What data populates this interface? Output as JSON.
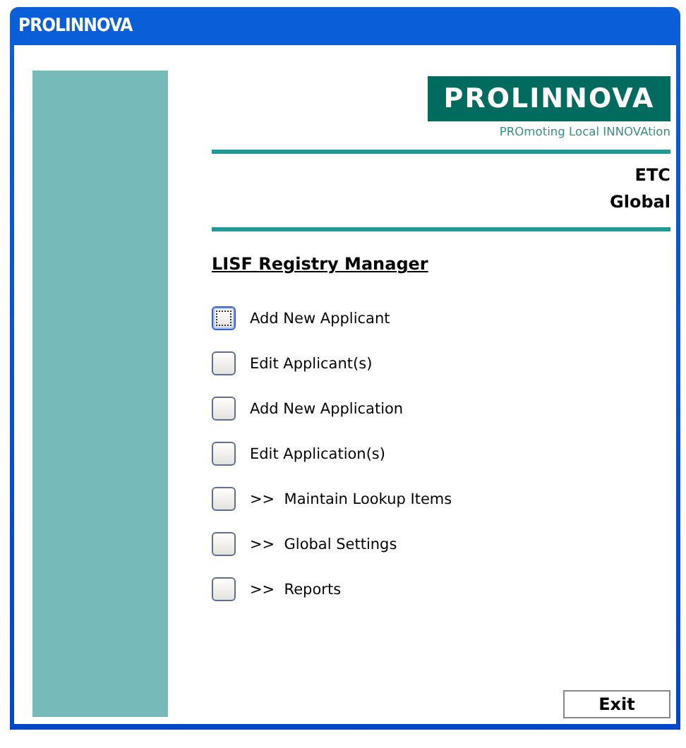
{
  "window": {
    "title": "PROLINNOVA"
  },
  "logo": {
    "name": "PROLINNOVA",
    "tagline": "PROmoting Local INNOVAtion"
  },
  "context": [
    "ETC",
    "Global"
  ],
  "heading": "LISF Registry Manager",
  "menu": [
    {
      "label": "Add New Applicant",
      "focused": true
    },
    {
      "label": "Edit Applicant(s)",
      "focused": false
    },
    {
      "label": "Add New Application",
      "focused": false
    },
    {
      "label": "Edit Application(s)",
      "focused": false
    },
    {
      "label": ">>  Maintain Lookup Items",
      "focused": false
    },
    {
      "label": ">>  Global Settings",
      "focused": false
    },
    {
      "label": ">>  Reports",
      "focused": false
    }
  ],
  "exit_button": "Exit"
}
